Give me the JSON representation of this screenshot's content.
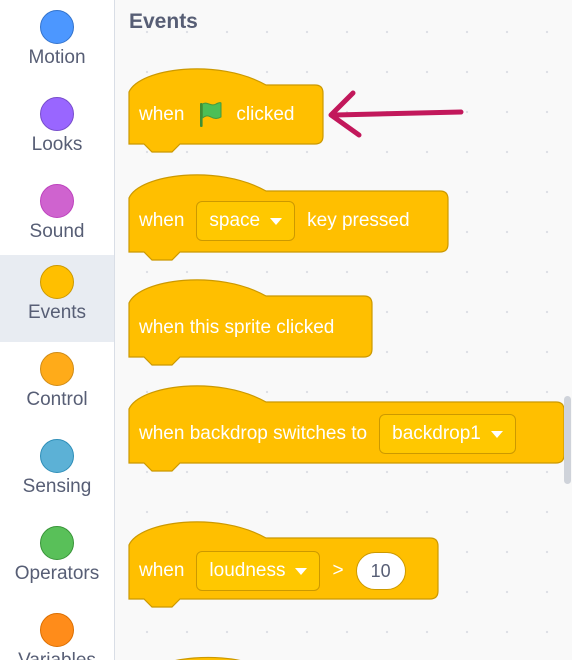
{
  "sidebar": {
    "categories": [
      {
        "label": "Motion",
        "color": "#4c97ff"
      },
      {
        "label": "Looks",
        "color": "#9966ff"
      },
      {
        "label": "Sound",
        "color": "#cf63cf"
      },
      {
        "label": "Events",
        "color": "#ffbf00",
        "selected": true
      },
      {
        "label": "Control",
        "color": "#ffab19"
      },
      {
        "label": "Sensing",
        "color": "#5cb1d6"
      },
      {
        "label": "Operators",
        "color": "#59c059"
      },
      {
        "label": "Variables",
        "color": "#ff8c1a"
      }
    ]
  },
  "palette": {
    "section_title": "Events",
    "block_color": "#ffbf00",
    "block_border": "#cc9900",
    "blocks": {
      "flag_clicked": {
        "when": "when",
        "clicked": "clicked",
        "icon": "green-flag-icon"
      },
      "key_pressed": {
        "when": "when",
        "key": "space",
        "suffix": "key pressed"
      },
      "sprite_clicked": {
        "text": "when this sprite clicked"
      },
      "backdrop_switches": {
        "text": "when backdrop switches to",
        "backdrop": "backdrop1"
      },
      "greater_than": {
        "when": "when",
        "sensor": "loudness",
        "operator": ">",
        "value": "10"
      }
    }
  },
  "annotation": {
    "icon": "arrow-left-icon",
    "color": "#c2185b"
  }
}
